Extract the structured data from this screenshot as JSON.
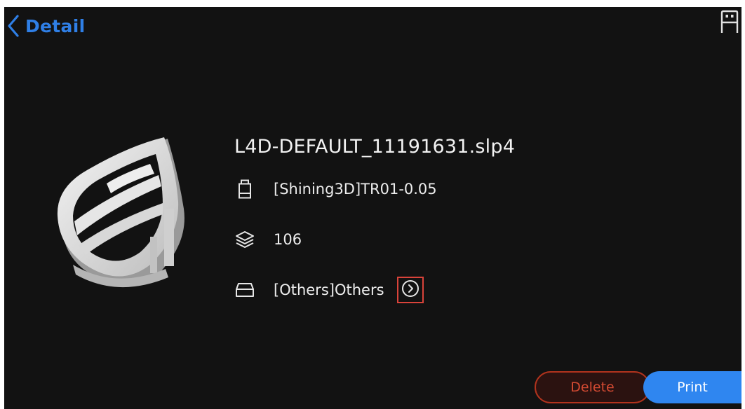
{
  "header": {
    "back_label": "Detail",
    "back_icon": "chevron-left-icon",
    "status_icon": "printer-usb-icon"
  },
  "file": {
    "name": "L4D-DEFAULT_11191631.slp4",
    "resin": "[Shining3D]TR01-0.05",
    "layers": "106",
    "material": "[Others]Others"
  },
  "actions": {
    "delete_label": "Delete",
    "print_label": "Print"
  },
  "colors": {
    "accent": "#2f86f0",
    "danger": "#d34a32",
    "background": "#121212",
    "highlight_border": "#d9433a"
  }
}
